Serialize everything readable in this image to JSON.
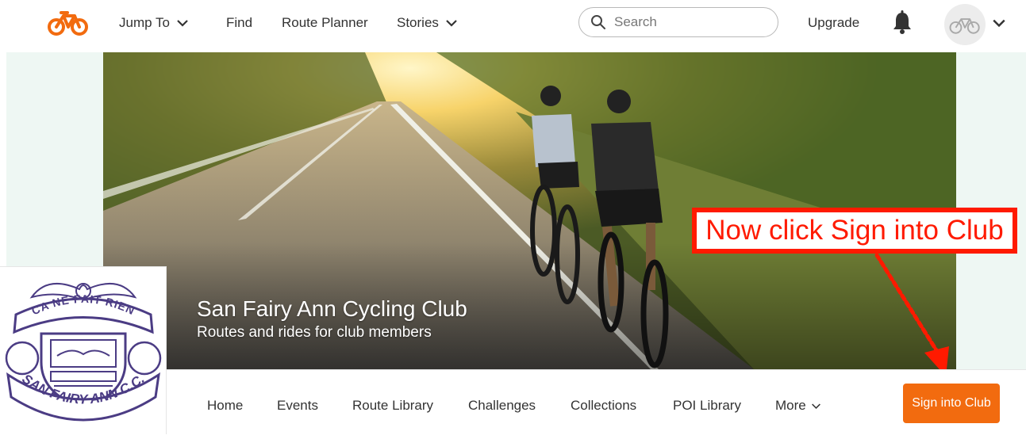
{
  "brand": {
    "accent": "#f26b0f",
    "annotation_color": "#ff1a00",
    "logo": "bicycle-logo-icon"
  },
  "topnav": {
    "jump_to": "Jump To",
    "find": "Find",
    "route_planner": "Route Planner",
    "stories": "Stories",
    "search_placeholder": "Search",
    "upgrade": "Upgrade"
  },
  "hero": {
    "club_name": "San Fairy Ann Cycling Club",
    "tagline": "Routes and rides for club members"
  },
  "annotation": {
    "text": "Now click Sign into Club"
  },
  "crest": {
    "top_text": "CA NE FAIT RIEN",
    "bottom_text": "SAN FAIRY ANN C.C."
  },
  "club_nav": {
    "items": [
      "Home",
      "Events",
      "Route Library",
      "Challenges",
      "Collections",
      "POI Library",
      "More"
    ],
    "sign_in_button": "Sign into Club"
  }
}
